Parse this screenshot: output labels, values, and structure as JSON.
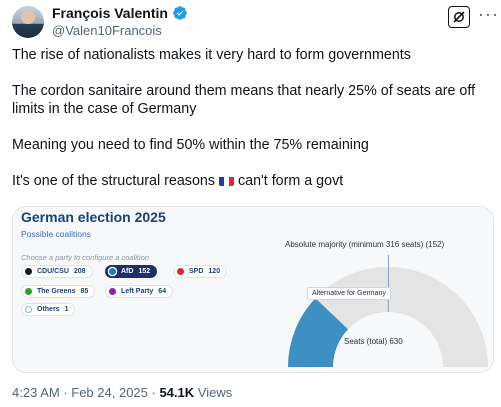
{
  "author": {
    "name": "François Valentin",
    "handle": "@Valen10Francois"
  },
  "tweet": {
    "line1": "The rise of nationalists makes it very hard to form governments",
    "line2": "The cordon sanitaire around them means that nearly 25% of seats are off limits in the case of Germany",
    "line3": "Meaning you need to find 50% within the 75% remaining",
    "line4_before": "It's one of the structural reasons",
    "line4_after": "can't form a govt"
  },
  "card": {
    "title": "German election 2025",
    "subtitle": "Possible coalitions",
    "hint": "Choose a party to configure a coalition",
    "parties": [
      {
        "name": "CDU/CSU",
        "seats": "208",
        "color": "#1a1a1a"
      },
      {
        "name": "AfD",
        "seats": "152",
        "color": "#1f7ab5"
      },
      {
        "name": "SPD",
        "seats": "120",
        "color": "#e3242b"
      },
      {
        "name": "The Greens",
        "seats": "85",
        "color": "#2ca02c"
      },
      {
        "name": "Left Party",
        "seats": "64",
        "color": "#8a1fb0"
      },
      {
        "name": "Others",
        "seats": "1",
        "color": "#ffffff"
      }
    ],
    "majority_label": "Absolute majority (minimum 316 seats) (152)",
    "tooltip": "Alternative for Germany",
    "seats_total_label": "Seats (total) 630",
    "gauge": {
      "total": 630,
      "majority": 316,
      "selected": 152,
      "selected_color": "#3d8fc4",
      "track_color": "#e4e4e4"
    }
  },
  "meta": {
    "time": "4:23 AM",
    "sep": " · ",
    "date": "Feb 24, 2025",
    "views_count": "54.1K",
    "views_label": " Views"
  },
  "icons": {
    "verified": "verified-badge-icon",
    "grok": "grok-icon",
    "more": "more-icon",
    "flag": "france-flag-icon"
  }
}
